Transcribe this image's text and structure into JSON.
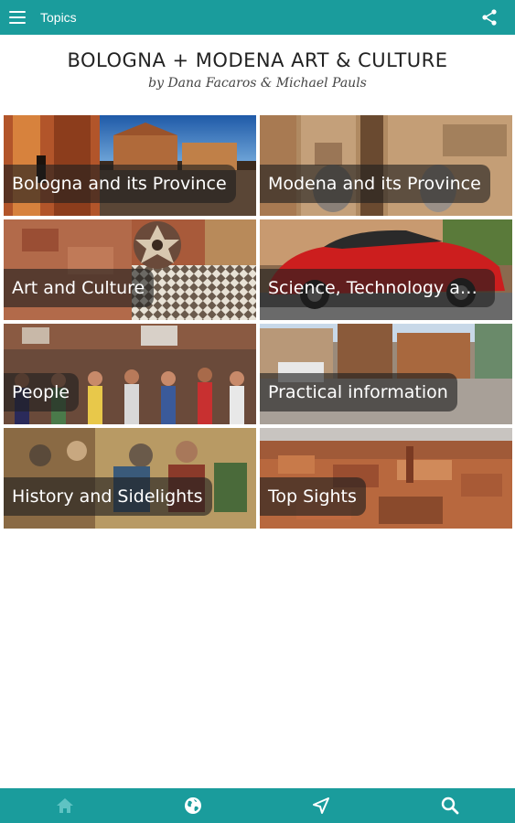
{
  "topbar": {
    "title": "Topics",
    "menu_icon": "hamburger-menu-icon",
    "share_icon": "share-icon"
  },
  "header": {
    "title": "BOLOGNA + MODENA ART & CULTURE",
    "subtitle": "by Dana Facaros & Michael Pauls"
  },
  "tiles": [
    {
      "label": "Bologna and its Province"
    },
    {
      "label": "Modena and its Province"
    },
    {
      "label": "Art and Culture"
    },
    {
      "label": "Science, Technology and Industry"
    },
    {
      "label": "People"
    },
    {
      "label": "Practical information"
    },
    {
      "label": "History and Sidelights"
    },
    {
      "label": "Top Sights"
    }
  ],
  "bottombar": {
    "items": [
      {
        "icon": "home-icon"
      },
      {
        "icon": "globe-icon"
      },
      {
        "icon": "navigation-arrow-icon"
      },
      {
        "icon": "search-icon"
      }
    ]
  },
  "colors": {
    "accent": "#1a9c9c",
    "label_bg": "#1e1e1e"
  }
}
